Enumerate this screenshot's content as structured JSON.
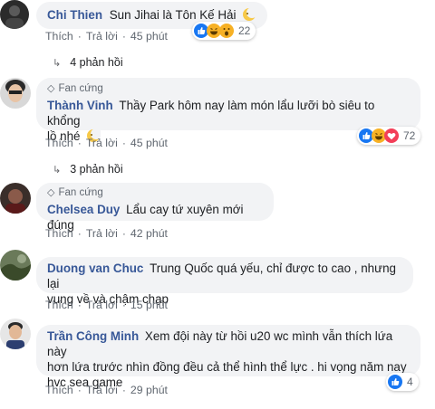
{
  "comments": [
    {
      "author": "Chi Thien",
      "text": "Sun Jihai là Tôn Kế Hải",
      "badge": "",
      "actions": {
        "like": "Thích",
        "reply": "Trả lời",
        "time": "45 phút"
      },
      "reaction_count": "22",
      "reactions": [
        "like",
        "haha",
        "wow"
      ],
      "replies": "4 phản hồi"
    },
    {
      "author": "Thành Vinh",
      "text_line1": "Thầy Park hôm nay làm món lẩu lưỡi bò siêu to khổng",
      "text_line2": "lồ nhé",
      "badge": "Fan cứng",
      "actions": {
        "like": "Thích",
        "reply": "Trả lời",
        "time": "45 phút"
      },
      "reaction_count": "72",
      "reactions": [
        "like",
        "haha",
        "love"
      ],
      "replies": "3 phản hồi"
    },
    {
      "author": "Chelsea Duy",
      "text": "Lẩu cay tứ xuyên mới đúng",
      "badge": "Fan cứng",
      "actions": {
        "like": "Thích",
        "reply": "Trả lời",
        "time": "42 phút"
      }
    },
    {
      "author": "Duong van Chuc",
      "text_line1": "Trung Quốc quá yếu, chỉ được to cao , nhưng lại",
      "text_line2": "vung về và chậm chạp",
      "actions": {
        "like": "Thích",
        "reply": "Trả lời",
        "time": "15 phút"
      }
    },
    {
      "author": "Trần Công Minh",
      "text_line1": "Xem đội này từ hồi u20 wc mình vẫn thích lứa này",
      "text_line2": "hơn lứa trước nhìn đồng đều cả thể hình thể lực . hi vọng năm nay",
      "text_line3": "hvc sea game",
      "actions": {
        "like": "Thích",
        "reply": "Trả lời",
        "time": "29 phút"
      },
      "reaction_count": "4",
      "reactions": [
        "like"
      ]
    }
  ],
  "colors": {
    "author": "#385898",
    "bubble": "#f2f3f5",
    "meta": "#606770",
    "like_blue": "#1877f2",
    "haha_yellow": "#f7b125",
    "love_red": "#f33e58"
  }
}
